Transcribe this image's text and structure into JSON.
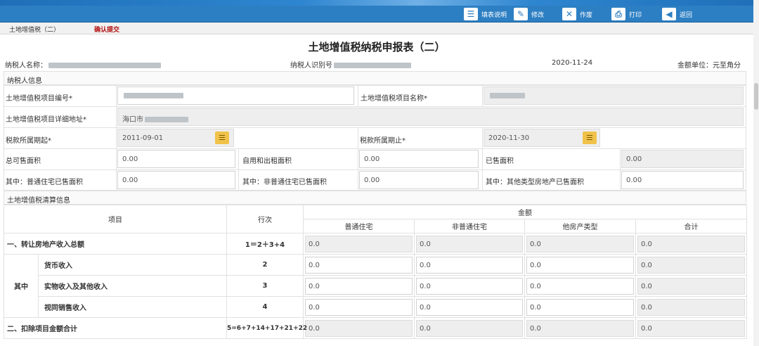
{
  "toolbar": {
    "buttons": [
      {
        "label": "填表说明",
        "icon": "form-help-icon"
      },
      {
        "label": "修改",
        "icon": "pencil-icon"
      },
      {
        "label": "作废",
        "icon": "void-document-icon"
      },
      {
        "label": "打印",
        "icon": "printer-icon"
      },
      {
        "label": "返回",
        "icon": "back-arrow-icon"
      }
    ],
    "colors": {
      "bar": "#2d7fc3"
    }
  },
  "tabs": {
    "current": "土地增值税（二）",
    "action": "确认提交"
  },
  "title": "土地增值税纳税申报表（二）",
  "meta": {
    "taxpayer_name_label": "纳税人名称",
    "taxpayer_id_label": "纳税人识别号",
    "date": "2020-11-24",
    "unit": "金额单位：元至角分"
  },
  "taxpayer_info": {
    "section_title": "纳税人信息",
    "project_no_label": "土地增值税项目编号*",
    "project_name_label": "土地增值税项目名称*",
    "address_label": "土地增值税项目详细地址*",
    "address_value": "海口市",
    "period_start_label": "税款所属期起*",
    "period_start": "2011-09-01",
    "period_end_label": "税款所属期止*",
    "period_end": "2020-11-30",
    "total_area_label": "总可售面积",
    "total_area": "0.00",
    "self_rent_label": "自用和出租面积",
    "self_rent": "0.00",
    "sold_area_label": "已售面积",
    "sold_area": "0.00",
    "ordinary_sold_label": "其中：普通住宅已售面积",
    "ordinary_sold": "0.00",
    "nonordinary_sold_label": "其中：非普通住宅已售面积",
    "nonordinary_sold": "0.00",
    "other_sold_label": "其中：其他类型房地产已售面积",
    "other_sold": "0.00"
  },
  "calc": {
    "section_title": "土地增值税清算信息",
    "headers": {
      "item": "项目",
      "row_no": "行次",
      "amount": "金额",
      "ordinary": "普通住宅",
      "nonordinary": "非普通住宅",
      "other": "他房产类型",
      "total": "合计"
    },
    "rows": [
      {
        "item": "一、转让房地产收入总额",
        "row_no": "1＝2＋3+4",
        "values": [
          "0.0",
          "0.0",
          "0.0",
          "0.0"
        ]
      },
      {
        "group": "其中",
        "item": "货币收入",
        "row_no": "2",
        "values": [
          "0.0",
          "0.0",
          "0.0",
          "0.0"
        ]
      },
      {
        "item": "实物收入及其他收入",
        "row_no": "3",
        "values": [
          "0.0",
          "0.0",
          "0.0",
          "0.0"
        ]
      },
      {
        "item": "视同销售收入",
        "row_no": "4",
        "values": [
          "0.0",
          "0.0",
          "0.0",
          "0.0"
        ]
      },
      {
        "item": "二、扣除项目金额合计",
        "row_no": "5=6+7+14+17+21+22",
        "values": [
          "0.0",
          "0.0",
          "0.0",
          "0.0"
        ]
      }
    ]
  }
}
